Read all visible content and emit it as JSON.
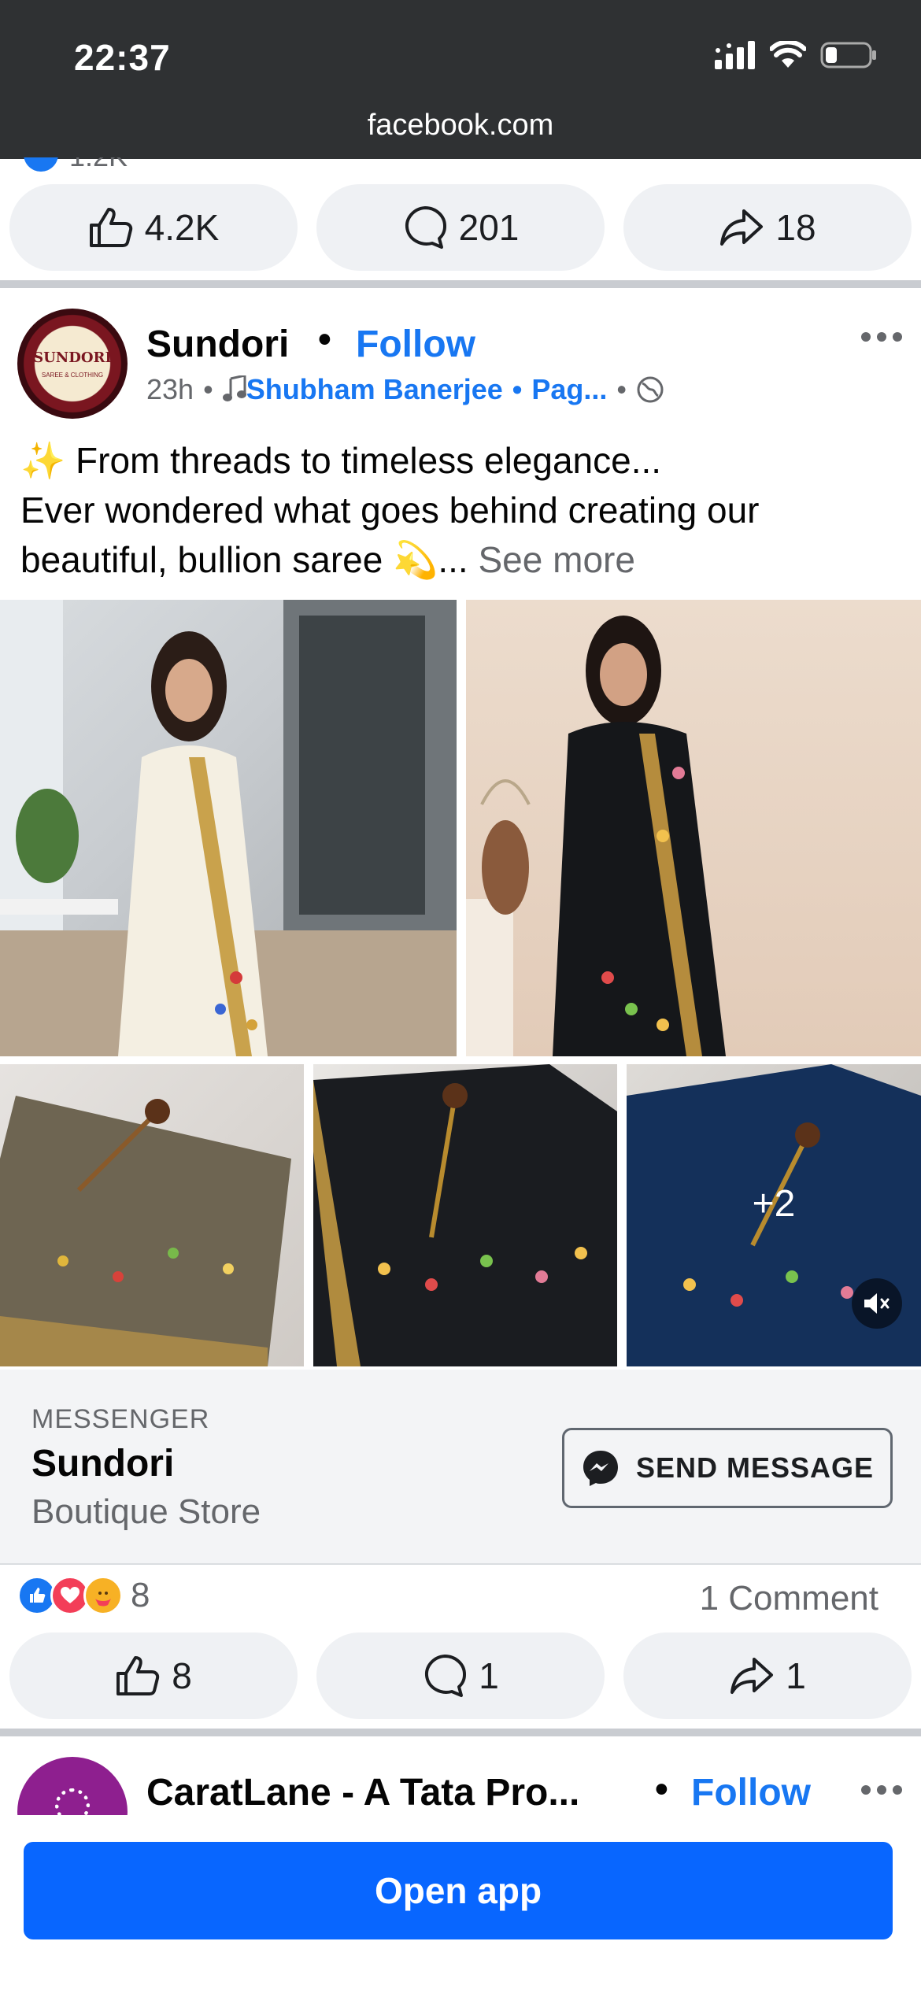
{
  "status_bar": {
    "time": "22:37"
  },
  "browser": {
    "url": "facebook.com"
  },
  "previous_post": {
    "reaction_count_peek": "1.2K",
    "actions": {
      "like": "4.2K",
      "comment": "201",
      "share": "18"
    }
  },
  "post": {
    "author": "Sundori",
    "separator": "•",
    "follow_label": "Follow",
    "time": "23h",
    "meta_dot": "•",
    "music_credit": "Shubham Banerjee",
    "page_label": "Pag...",
    "text_line1": "✨ From threads to timeless elegance...",
    "text_line2": "Ever wondered what goes behind creating our",
    "text_line3": "beautiful, bullion saree 💫...",
    "see_more": "See more",
    "avatar_text": "SUNDORI",
    "avatar_sub": "SAREE & CLOTHING",
    "more_images_label": "+2",
    "cta": {
      "kicker": "MESSENGER",
      "title": "Sundori",
      "subtitle": "Boutique Store",
      "button_label": "SEND MESSAGE"
    },
    "reactions_count": "8",
    "comments_label": "1 Comment",
    "actions": {
      "like": "8",
      "comment": "1",
      "share": "1"
    }
  },
  "next_post": {
    "author": "CaratLane - A Tata Pro...",
    "separator": "•",
    "follow_label": "Follow"
  },
  "bottom": {
    "open_app_label": "Open app"
  },
  "colors": {
    "accent": "#1877f2",
    "button_primary": "#0866ff",
    "status_bar": "#2f3133"
  }
}
